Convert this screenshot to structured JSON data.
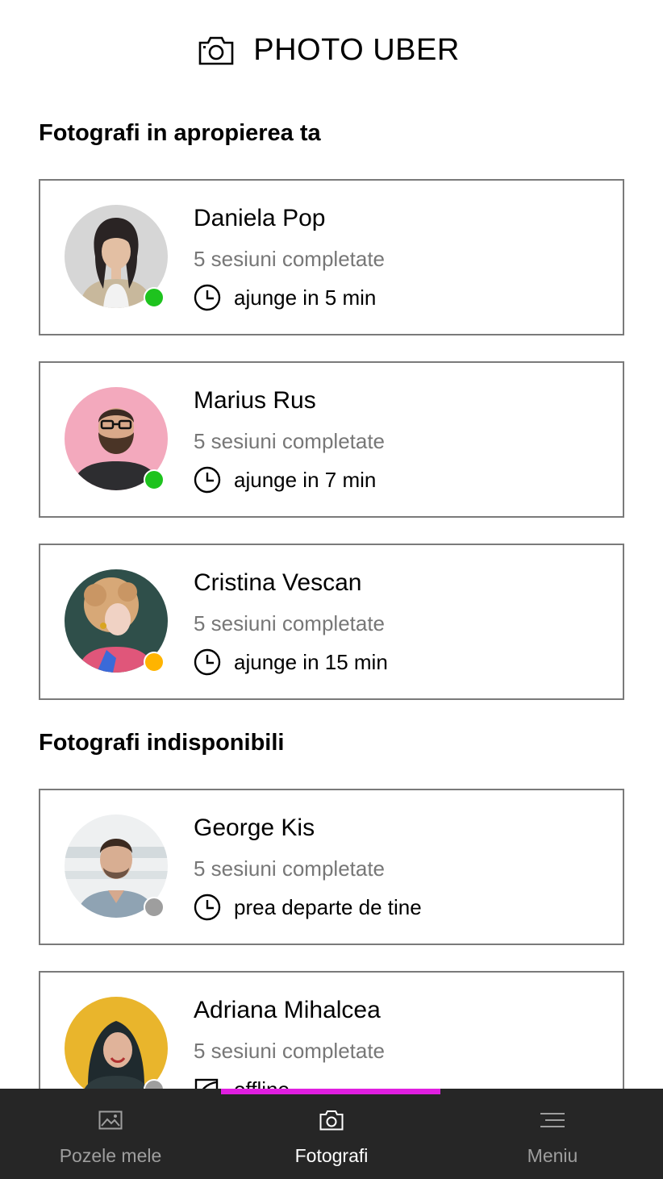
{
  "app": {
    "title": "PHOTO UBER"
  },
  "sections": {
    "nearby_title": "Fotografi in apropierea ta",
    "unavailable_title": "Fotografi indisponibili"
  },
  "photographers": [
    {
      "name": "Daniela Pop",
      "sessions": "5 sesiuni completate",
      "eta": "ajunge in 5 min",
      "status_color": "#1ec31e"
    },
    {
      "name": "Marius Rus",
      "sessions": "5 sesiuni completate",
      "eta": "ajunge in 7 min",
      "status_color": "#1ec31e"
    },
    {
      "name": "Cristina Vescan",
      "sessions": "5 sesiuni completate",
      "eta": "ajunge in 15 min",
      "status_color": "#ffb400"
    },
    {
      "name": "George Kis",
      "sessions": "5 sesiuni completate",
      "eta": "prea departe de tine",
      "status_color": "#9e9e9e"
    },
    {
      "name": "Adriana Mihalcea",
      "sessions": "5 sesiuni completate",
      "eta": "offline",
      "status_color": "#9e9e9e"
    }
  ],
  "nav": {
    "items": [
      {
        "label": "Pozele mele",
        "icon": "image-icon"
      },
      {
        "label": "Fotografi",
        "icon": "camera-icon"
      },
      {
        "label": "Meniu",
        "icon": "menu-icon"
      }
    ],
    "active_index": 1,
    "accent_color": "#e01ee0"
  },
  "colors": {
    "online": "#1ec31e",
    "away": "#ffb400",
    "offline": "#9e9e9e",
    "nav_background": "#262626"
  }
}
